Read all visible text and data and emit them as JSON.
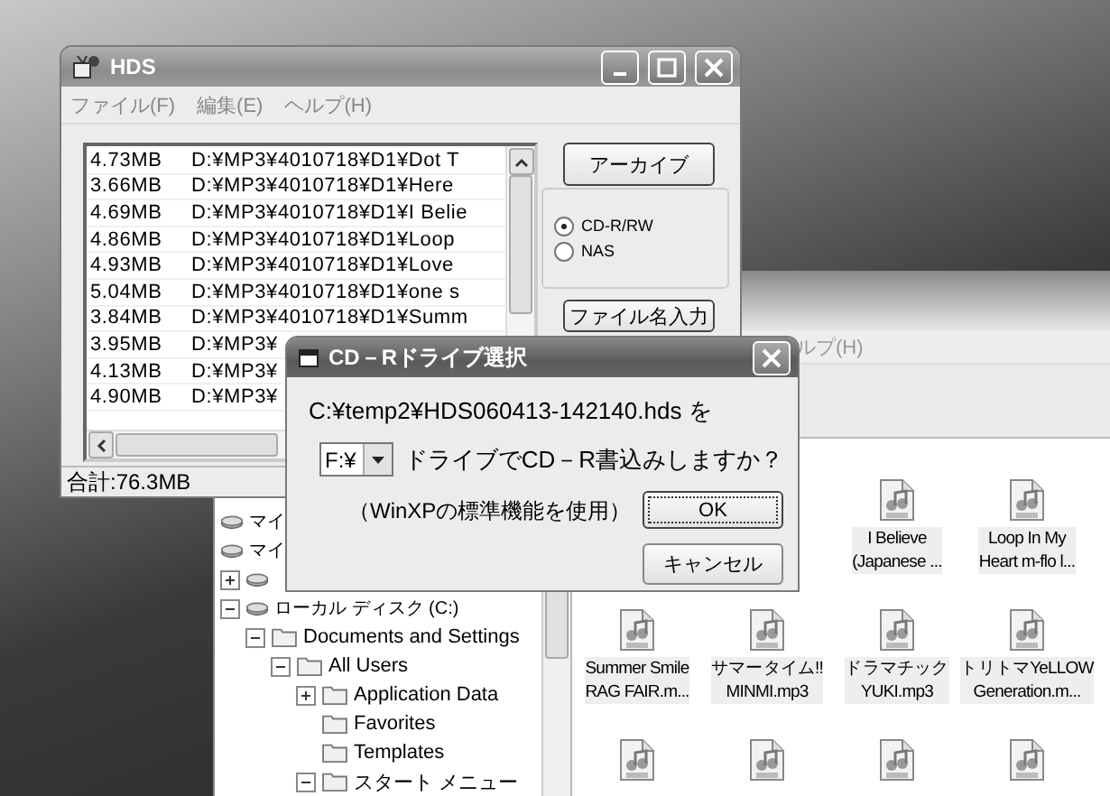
{
  "hds": {
    "title": "HDS",
    "menu": [
      "ファイル(F)",
      "編集(E)",
      "ヘルプ(H)"
    ],
    "rows": [
      {
        "size": "4.73MB",
        "path": "D:¥MP3¥4010718¥D1¥Dot T"
      },
      {
        "size": "3.66MB",
        "path": "D:¥MP3¥4010718¥D1¥Here"
      },
      {
        "size": "4.69MB",
        "path": "D:¥MP3¥4010718¥D1¥I Belie"
      },
      {
        "size": "4.86MB",
        "path": "D:¥MP3¥4010718¥D1¥Loop"
      },
      {
        "size": "4.93MB",
        "path": "D:¥MP3¥4010718¥D1¥Love"
      },
      {
        "size": "5.04MB",
        "path": "D:¥MP3¥4010718¥D1¥one s"
      },
      {
        "size": "3.84MB",
        "path": "D:¥MP3¥4010718¥D1¥Summ"
      },
      {
        "size": "3.95MB",
        "path": "D:¥MP3¥"
      },
      {
        "size": "4.13MB",
        "path": "D:¥MP3¥"
      },
      {
        "size": "4.90MB",
        "path": "D:¥MP3¥"
      }
    ],
    "archive_button": "アーカイブ",
    "targets": [
      {
        "label": "CD-R/RW",
        "selected": true
      },
      {
        "label": "NAS",
        "selected": false
      }
    ],
    "filename_button": "ファイル名入力",
    "total": "合計:76.3MB"
  },
  "dialog": {
    "title": "CD－Rドライブ選択",
    "file": "C:¥temp2¥HDS060413-142140.hds を",
    "drive": "F:¥",
    "question": "ドライブでCD－R書込みしますか？",
    "note": "（WinXPの標準機能を使用）",
    "ok": "OK",
    "cancel": "キャンセル"
  },
  "explorer": {
    "menu": "ルプ(H)",
    "tree": [
      {
        "label": "マイ"
      },
      {
        "label": "マイ"
      },
      {
        "expanded": false
      },
      {
        "label": "ローカル ディスク (C:)",
        "expanded": true,
        "children": [
          {
            "label": "Documents and Settings",
            "expanded": true,
            "children": [
              {
                "label": "All Users",
                "expanded": true,
                "children": [
                  {
                    "label": "Application Data",
                    "expanded": false
                  },
                  {
                    "label": "Favorites"
                  },
                  {
                    "label": "Templates"
                  },
                  {
                    "label": "スタート メニュー",
                    "expanded": true
                  }
                ]
              }
            ]
          }
        ]
      }
    ],
    "files": [
      [
        {
          "kind": "mp3",
          "labels": [
            "I Believe",
            "(Japanese ..."
          ]
        },
        {
          "kind": "mp3",
          "labels": [
            "Loop In My",
            "Heart m-flo l..."
          ]
        }
      ],
      [
        {
          "kind": "mp3",
          "labels": [
            "Summer Smile",
            "RAG FAIR.m..."
          ]
        },
        {
          "kind": "mp3",
          "labels": [
            "サマータイム!!",
            "MINMI.mp3"
          ]
        },
        {
          "kind": "mp3",
          "labels": [
            "ドラマチック",
            "YUKI.mp3"
          ]
        },
        {
          "kind": "mp3",
          "labels": [
            "トリトマYeLLOW",
            "Generation.m..."
          ]
        }
      ],
      [
        {
          "kind": "mp3"
        },
        {
          "kind": "mp3"
        },
        {
          "kind": "mp3"
        },
        {
          "kind": "mp3"
        }
      ]
    ]
  }
}
